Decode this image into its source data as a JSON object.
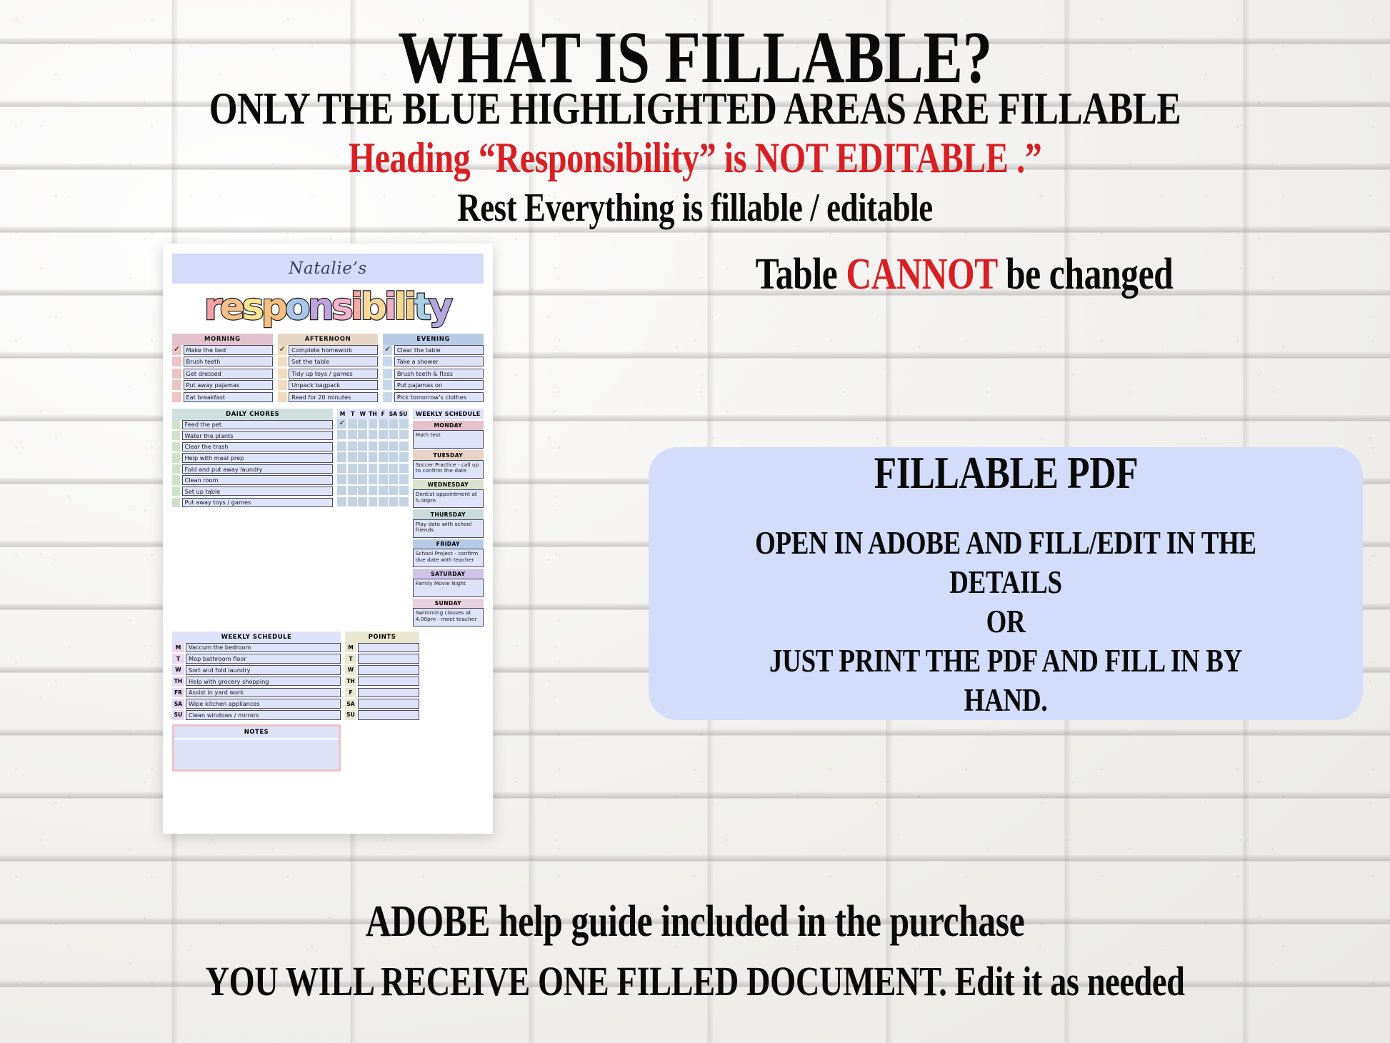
{
  "headline": {
    "title": "WHAT IS FILLABLE?",
    "subtitle": "ONLY THE BLUE HIGHLIGHTED AREAS ARE FILLABLE",
    "warning": "Heading “Responsibility” is NOT EDITABLE .”",
    "note": "Rest Everything is fillable / editable",
    "table_note_pre": "Table ",
    "table_note_red": "CANNOT",
    "table_note_post": " be changed"
  },
  "callout": {
    "title": "FILLABLE PDF",
    "line1": "OPEN IN ADOBE AND FILL/EDIT IN THE",
    "line2": "DETAILS",
    "line3": "OR",
    "line4": "JUST PRINT THE PDF AND FILL IN BY HAND."
  },
  "footer": {
    "line1": "ADOBE help guide included in the purchase",
    "line2": "YOU WILL RECEIVE ONE FILLED DOCUMENT. Edit it as needed"
  },
  "planner": {
    "name": "Natalie’s",
    "big_word": "responsibility",
    "big_word_colors": [
      "#f4a0a4",
      "#f8c089",
      "#fbe58e",
      "#f7c07f",
      "#a9c7e8",
      "#bda4de",
      "#f2b3cf",
      "#f6a9a5",
      "#f7d89a",
      "#f2b0c6",
      "#f6d98e",
      "#f2cf8a",
      "#a9cfe8",
      "#b6a8df",
      "#f2b3cf"
    ],
    "columns": [
      {
        "header": "MORNING",
        "header_bg": "#e3c2cd",
        "tick_bg": "#eec3c6",
        "tasks": [
          {
            "text": "Make the bed",
            "checked": true
          },
          {
            "text": "Brush teeth",
            "checked": false
          },
          {
            "text": "Get dressed",
            "checked": false
          },
          {
            "text": "Put away pajamas",
            "checked": false
          },
          {
            "text": "Eat breakfast",
            "checked": false
          }
        ]
      },
      {
        "header": "AFTERNOON",
        "header_bg": "#e6d6c6",
        "tick_bg": "#f3dcbe",
        "tasks": [
          {
            "text": "Complete homework",
            "checked": true
          },
          {
            "text": "Set the table",
            "checked": false
          },
          {
            "text": "Tidy up toys / games",
            "checked": false
          },
          {
            "text": "Unpack bagpack",
            "checked": false
          },
          {
            "text": "Read for 20 minutes",
            "checked": false
          }
        ]
      },
      {
        "header": "EVENING",
        "header_bg": "#b8cbe6",
        "tick_bg": "#c5d7ec",
        "tasks": [
          {
            "text": "Clear the table",
            "checked": true
          },
          {
            "text": "Take a shower",
            "checked": false
          },
          {
            "text": "Brush teeth & floss",
            "checked": false
          },
          {
            "text": "Put pajamas on",
            "checked": false
          },
          {
            "text": "Pick tomorrow’s clothes",
            "checked": false
          }
        ]
      }
    ],
    "daily_chores": {
      "header": "DAILY CHORES",
      "items": [
        "Feed the pet",
        "Water the plants",
        "Clear the trash",
        "Help with meal prep",
        "Fold and put away laundry",
        "Clean room",
        "Set up table",
        "Put away toys / games"
      ]
    },
    "day_grid": {
      "headers": [
        "M",
        "T",
        "W",
        "TH",
        "F",
        "SA",
        "SU"
      ],
      "checked": [
        [
          true,
          false,
          false,
          false,
          false,
          false,
          false
        ],
        [
          false,
          false,
          false,
          false,
          false,
          false,
          false
        ],
        [
          false,
          false,
          false,
          false,
          false,
          false,
          false
        ],
        [
          false,
          false,
          false,
          false,
          false,
          false,
          false
        ],
        [
          false,
          false,
          false,
          false,
          false,
          false,
          false
        ],
        [
          false,
          false,
          false,
          false,
          false,
          false,
          false
        ],
        [
          false,
          false,
          false,
          false,
          false,
          false,
          false
        ],
        [
          false,
          false,
          false,
          false,
          false,
          false,
          false
        ]
      ]
    },
    "weekly_schedule_right": {
      "title": "WEEKLY SCHEDULE",
      "days": [
        {
          "day": "MONDAY",
          "bg": "#e3c2cd",
          "note": "Math test"
        },
        {
          "day": "TUESDAY",
          "bg": "#e6d2c6",
          "note": "Soccer Practice - call up to confirm the date"
        },
        {
          "day": "WEDNESDAY",
          "bg": "#dbe2cf",
          "note": "Dentist appointment at 5.00pm"
        },
        {
          "day": "THURSDAY",
          "bg": "#c9dbdd",
          "note": "Play date with school friends"
        },
        {
          "day": "FRIDAY",
          "bg": "#b8cbe6",
          "note": "School Project - confirm due date with teacher"
        },
        {
          "day": "SATURDAY",
          "bg": "#cfc3e8",
          "note": "Family Movie Night"
        },
        {
          "day": "SUNDAY",
          "bg": "#e7cfe0",
          "note": "Swimming classes at 4.00pm - meet teacher"
        }
      ]
    },
    "weekly_tasks": {
      "header": "WEEKLY SCHEDULE",
      "rows": [
        {
          "day": "M",
          "task": "Vaccum the bedroom"
        },
        {
          "day": "T",
          "task": "Mop bathroom floor"
        },
        {
          "day": "W",
          "task": "Sort and fold laundry"
        },
        {
          "day": "TH",
          "task": "Help with grocery shopping"
        },
        {
          "day": "FR",
          "task": "Assist in yard work"
        },
        {
          "day": "SA",
          "task": "Wipe kitchen appliances"
        },
        {
          "day": "SU",
          "task": "Clean windows / mirrors"
        }
      ]
    },
    "points": {
      "header": "POINTS",
      "rows": [
        {
          "day": "M",
          "value": ""
        },
        {
          "day": "T",
          "value": ""
        },
        {
          "day": "W",
          "value": ""
        },
        {
          "day": "TH",
          "value": ""
        },
        {
          "day": "F",
          "value": ""
        },
        {
          "day": "SA",
          "value": ""
        },
        {
          "day": "SU",
          "value": ""
        }
      ]
    },
    "notes": {
      "header": "NOTES",
      "value": ""
    }
  },
  "colors": {
    "fillable_blue": "#d3dcfb",
    "field_blue": "#dfe3f7",
    "alert_red": "#d81f23",
    "grid_blue": "#c3d3e1"
  }
}
